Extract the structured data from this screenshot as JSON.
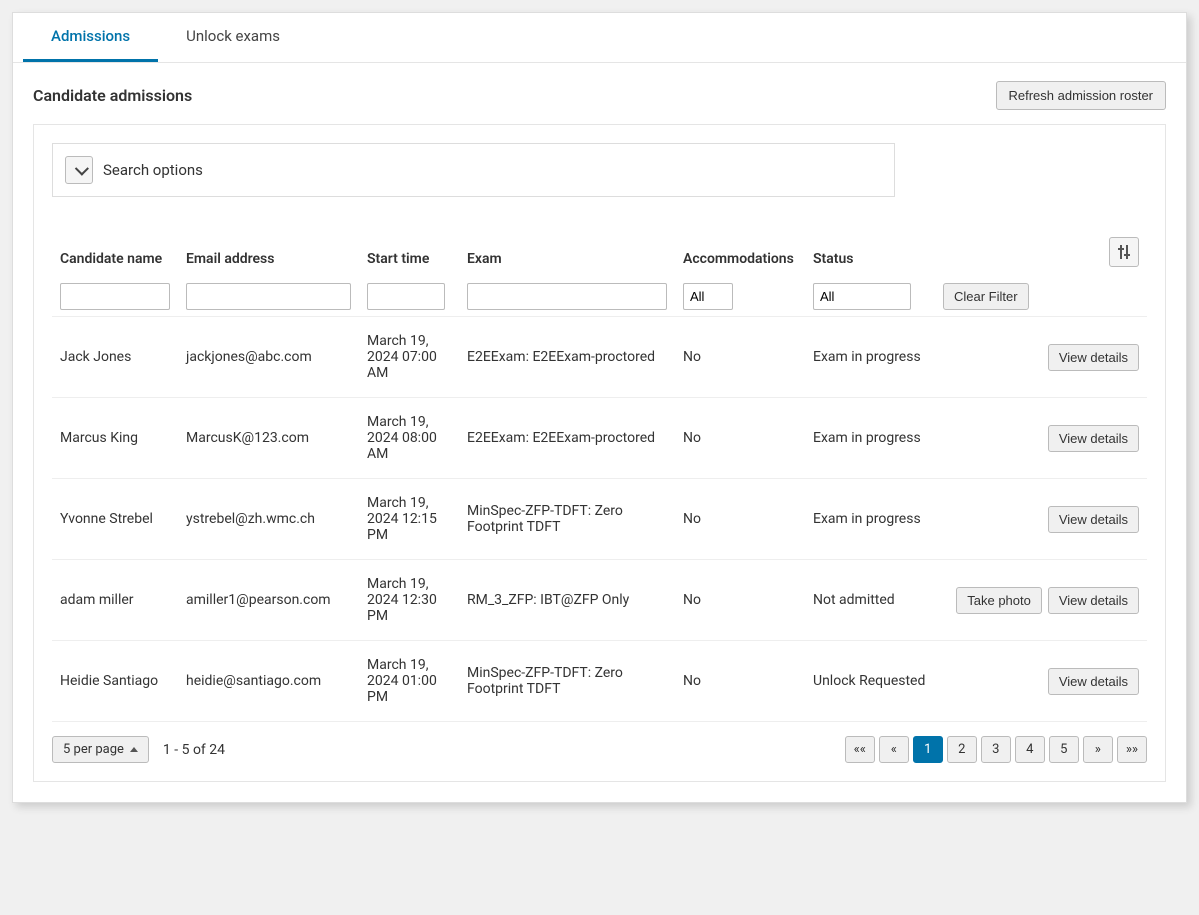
{
  "tabs": [
    {
      "label": "Admissions",
      "active": true
    },
    {
      "label": "Unlock exams",
      "active": false
    }
  ],
  "section": {
    "title": "Candidate admissions",
    "refresh_label": "Refresh admission roster"
  },
  "search_options": {
    "label": "Search options"
  },
  "columns": {
    "name": "Candidate name",
    "email": "Email address",
    "start": "Start time",
    "exam": "Exam",
    "accom": "Accommodations",
    "status": "Status"
  },
  "filters": {
    "accom_value": "All",
    "status_value": "All",
    "clear_label": "Clear Filter"
  },
  "rows": [
    {
      "name": "Jack Jones",
      "email": "jackjones@abc.com",
      "start": "March 19, 2024 07:00 AM",
      "exam": "E2EExam: E2EExam-proctored",
      "accom": "No",
      "status": "Exam in progress",
      "take_photo": false
    },
    {
      "name": "Marcus King",
      "email": "MarcusK@123.com",
      "start": "March 19, 2024 08:00 AM",
      "exam": "E2EExam: E2EExam-proctored",
      "accom": "No",
      "status": "Exam in progress",
      "take_photo": false
    },
    {
      "name": "Yvonne Strebel",
      "email": "ystrebel@zh.wmc.ch",
      "start": "March 19, 2024 12:15 PM",
      "exam": "MinSpec-ZFP-TDFT: Zero Footprint TDFT",
      "accom": "No",
      "status": "Exam in progress",
      "take_photo": false
    },
    {
      "name": "adam miller",
      "email": "amiller1@pearson.com",
      "start": "March 19, 2024 12:30 PM",
      "exam": "RM_3_ZFP: IBT@ZFP Only",
      "accom": "No",
      "status": "Not admitted",
      "take_photo": true
    },
    {
      "name": "Heidie Santiago",
      "email": "heidie@santiago.com",
      "start": "March 19, 2024 01:00 PM",
      "exam": "MinSpec-ZFP-TDFT: Zero Footprint TDFT",
      "accom": "No",
      "status": "Unlock Requested",
      "take_photo": false
    }
  ],
  "actions": {
    "take_photo_label": "Take photo",
    "view_details_label": "View details"
  },
  "footer": {
    "per_page_label": "5 per page",
    "range_text": "1 - 5 of 24"
  },
  "pagination": {
    "first": "««",
    "prev": "«",
    "pages": [
      "1",
      "2",
      "3",
      "4",
      "5"
    ],
    "active": "1",
    "next": "»",
    "last": "»»"
  }
}
